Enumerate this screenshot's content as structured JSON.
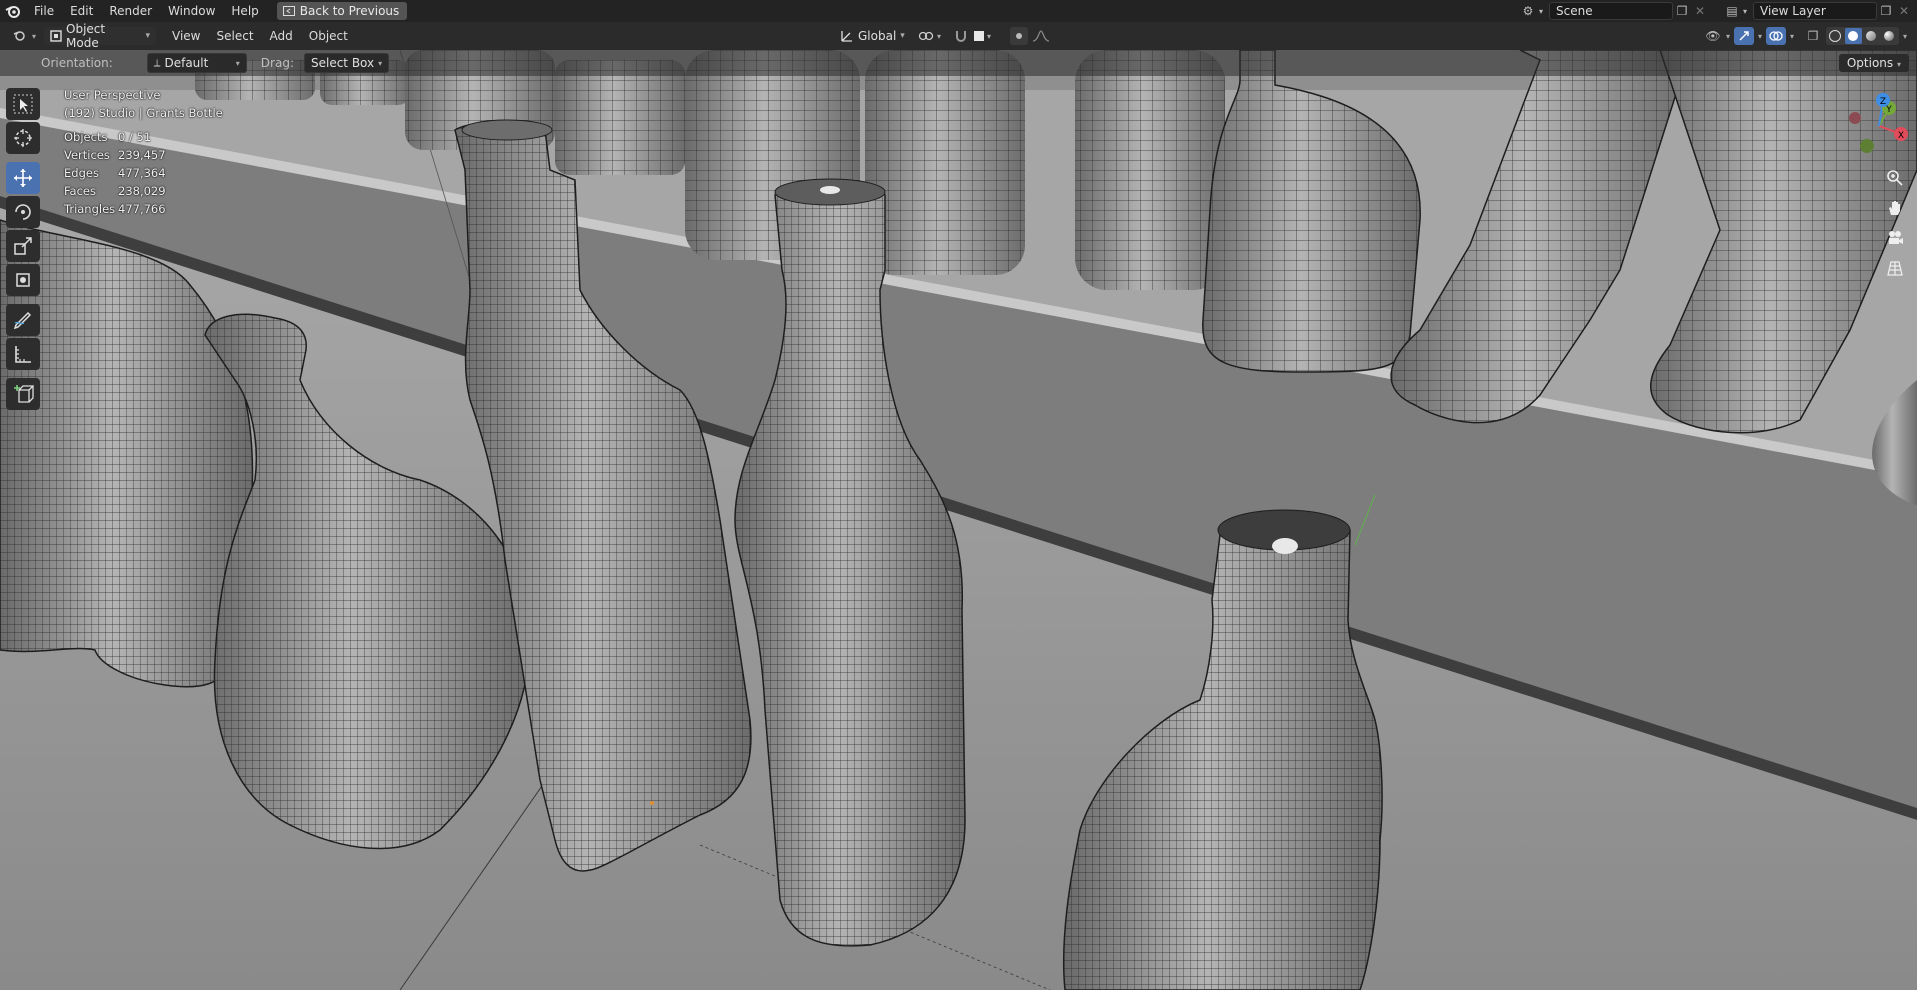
{
  "topbar": {
    "menus": [
      "File",
      "Edit",
      "Render",
      "Window",
      "Help"
    ],
    "back_button": "Back to Previous",
    "scene_name": "Scene",
    "view_layer": "View Layer"
  },
  "header": {
    "mode": "Object Mode",
    "menus": [
      "View",
      "Select",
      "Add",
      "Object"
    ],
    "transform_orientation": "Global"
  },
  "tool_settings": {
    "orientation_label": "Orientation:",
    "orientation_value": "Default",
    "drag_label": "Drag:",
    "drag_value": "Select Box",
    "options_label": "Options"
  },
  "viewport_info": {
    "perspective": "User Perspective",
    "object_info": "(192) Studio | Grants Bottle",
    "stats": [
      {
        "label": "Objects",
        "value": "0 / 51"
      },
      {
        "label": "Vertices",
        "value": "239,457"
      },
      {
        "label": "Edges",
        "value": "477,364"
      },
      {
        "label": "Faces",
        "value": "238,029"
      },
      {
        "label": "Triangles",
        "value": "477,766"
      }
    ]
  },
  "gizmo": {
    "x": "X",
    "y": "Y",
    "z": "Z"
  },
  "colors": {
    "active_tool": "#4a72b0",
    "background": "#8e8e8e",
    "gizmo_x": "#e24b5a",
    "gizmo_y": "#74a839",
    "gizmo_z": "#3f8ee6"
  }
}
